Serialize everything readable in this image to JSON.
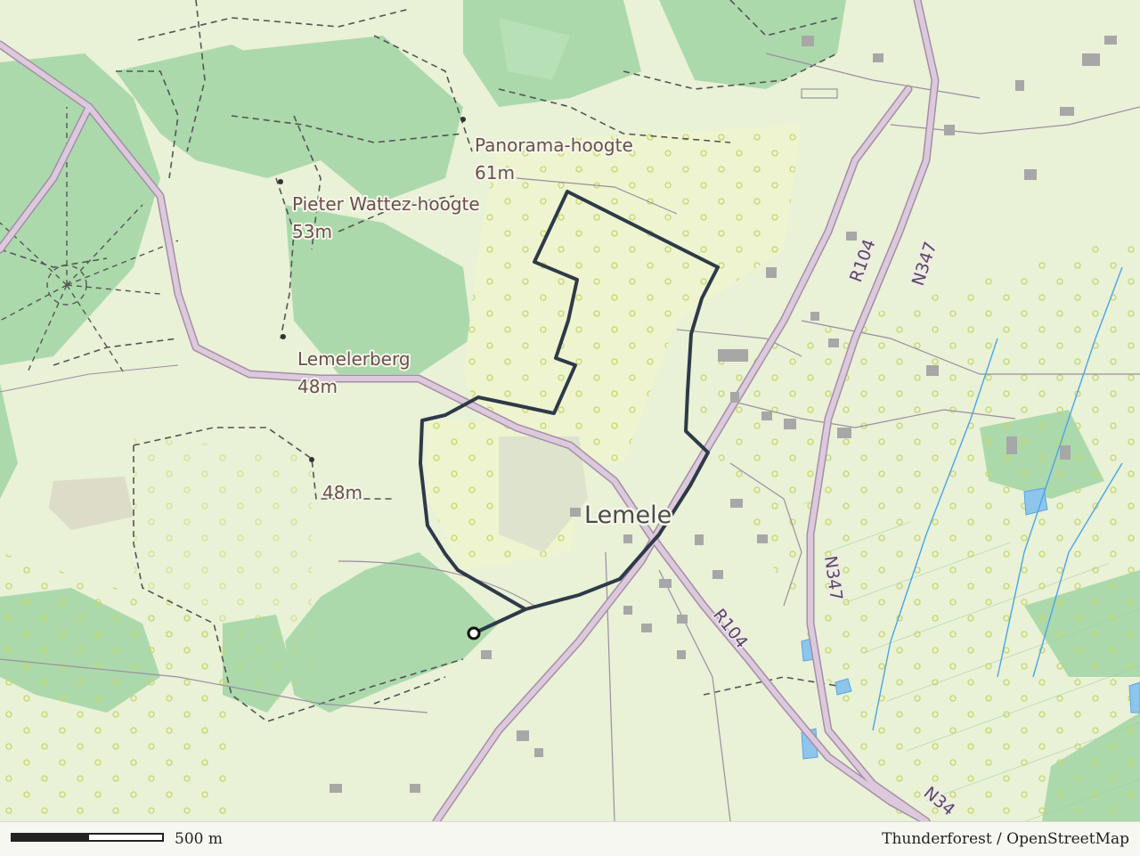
{
  "map": {
    "labels": {
      "panorama": "Panorama-hoogte",
      "panorama_elev": "61m",
      "pieter": "Pieter Wattez-hoogte",
      "pieter_elev": "53m",
      "lemelerberg": "Lemelerberg",
      "lemelerberg_elev": "48m",
      "spot_elev": "48m",
      "town": "Lemele",
      "road_r104_north": "R104",
      "road_r104_south": "R104",
      "road_n347_north": "N347",
      "road_n347_mid": "N347",
      "road_n347_south": "N34"
    },
    "colors": {
      "forest": "#a8d8a8",
      "meadow": "#e8f0d4",
      "route": "#2e3a48",
      "road_main": "#d9c3d9",
      "water": "#8ec5ec"
    }
  },
  "footer": {
    "scale_label": "500 m",
    "attribution": "Thunderforest / OpenStreetMap"
  }
}
